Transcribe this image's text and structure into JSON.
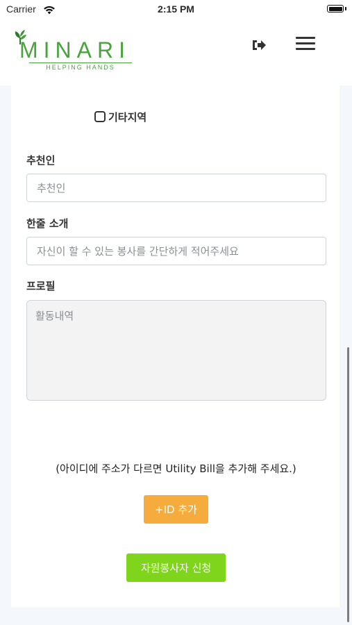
{
  "status_bar": {
    "carrier": "Carrier",
    "time": "2:15 PM"
  },
  "header": {
    "logo_word": "MINARI",
    "logo_tagline": "HELPING HANDS",
    "brand_color": "#4aa33e",
    "logout_icon": "sign-out-icon",
    "menu_icon": "hamburger-menu-icon"
  },
  "form": {
    "other_region_label": "기타지역",
    "other_region_checked": false,
    "referrer": {
      "label": "추천인",
      "placeholder": "추천인",
      "value": ""
    },
    "intro": {
      "label": "한줄 소개",
      "placeholder": "자신이 할 수 있는 봉사를 간단하게 적어주세요",
      "value": ""
    },
    "profile": {
      "label": "프로필",
      "placeholder": "활동내역",
      "value": ""
    },
    "notice": "(아이디에 주소가 다르면 Utility Bill을 추가해 주세요.)",
    "add_id_button": "+ID 추가",
    "add_id_color": "#f5ac3d",
    "apply_button": "자원봉사자 신청",
    "apply_color": "#7fd51b"
  }
}
